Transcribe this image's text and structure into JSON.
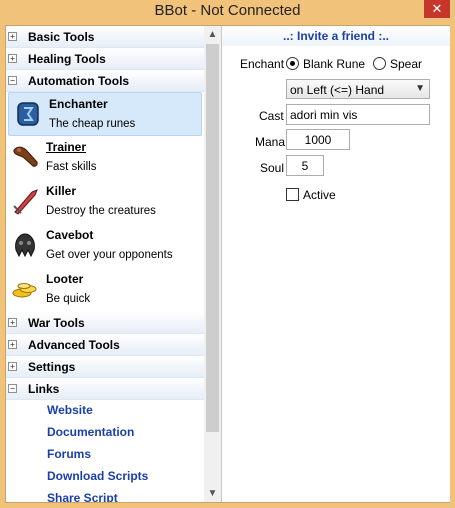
{
  "window": {
    "title": "BBot - Not Connected",
    "close_glyph": "✕"
  },
  "sidebar": {
    "groups_top": [
      {
        "label": "Basic Tools",
        "toggle": "+"
      },
      {
        "label": "Healing Tools",
        "toggle": "+"
      },
      {
        "label": "Automation Tools",
        "toggle": "−"
      }
    ],
    "items": [
      {
        "name": "Enchanter",
        "desc": "The cheap runes",
        "icon": "rune-icon"
      },
      {
        "name": "Trainer",
        "desc": "Fast skills",
        "icon": "club-icon"
      },
      {
        "name": "Killer",
        "desc": "Destroy the creatures",
        "icon": "sword-icon"
      },
      {
        "name": "Cavebot",
        "desc": "Get over your opponents",
        "icon": "helmet-icon"
      },
      {
        "name": "Looter",
        "desc": "Be quick",
        "icon": "gold-icon"
      }
    ],
    "groups_bottom": [
      {
        "label": "War Tools",
        "toggle": "+"
      },
      {
        "label": "Advanced Tools",
        "toggle": "+"
      },
      {
        "label": "Settings",
        "toggle": "+"
      },
      {
        "label": "Links",
        "toggle": "−"
      }
    ],
    "links": [
      "Website",
      "Documentation",
      "Forums",
      "Download Scripts",
      "Share Script"
    ]
  },
  "scrollbar": {
    "up": "▲",
    "down": "▼"
  },
  "enchanter": {
    "invite": "..: Invite a friend :..",
    "enchant_label": "Enchant",
    "option_blank": "Blank Rune",
    "option_spear": "Spear",
    "hand_select": "on Left (<=) Hand",
    "select_arrow": "▼",
    "cast_label": "Cast",
    "cast_value": "adori min vis",
    "mana_label": "Mana",
    "mana_value": "1000",
    "soul_label": "Soul",
    "soul_value": "5",
    "active_label": "Active"
  }
}
